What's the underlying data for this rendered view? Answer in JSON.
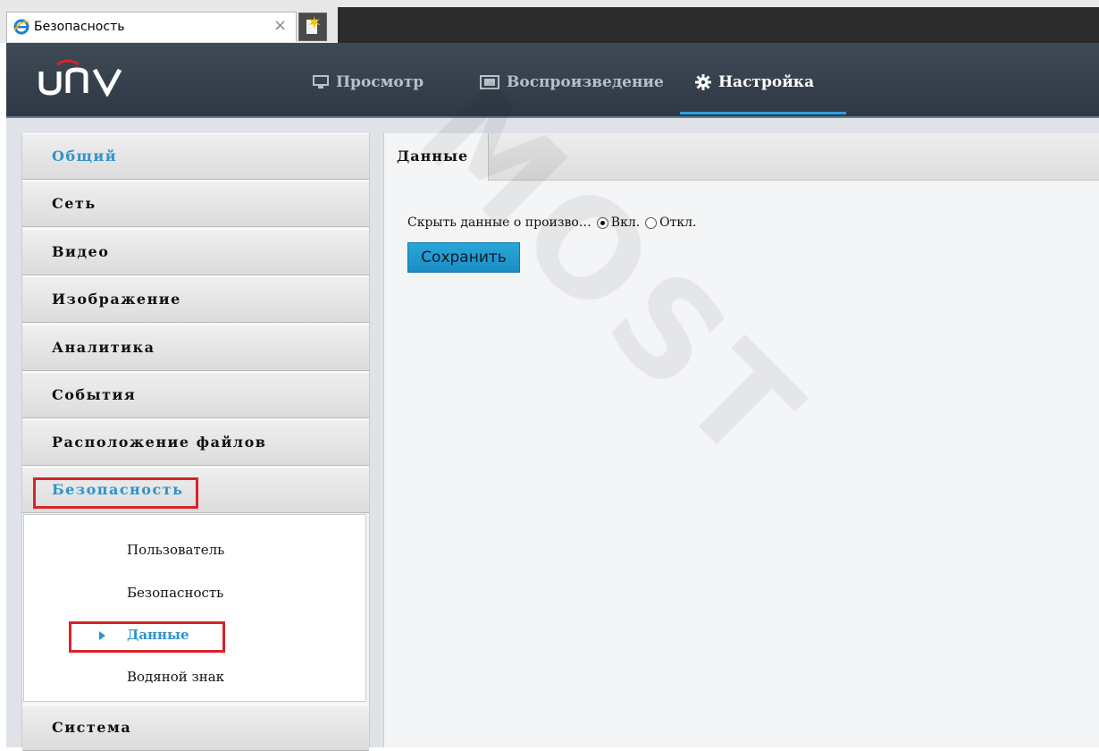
{
  "browser": {
    "tab_title": "Безопасность",
    "tab_close": "×"
  },
  "header": {
    "logo": "UNV",
    "nav": [
      {
        "label": "Просмотр",
        "icon": "monitor-icon"
      },
      {
        "label": "Воспроизведение",
        "icon": "film-icon"
      },
      {
        "label": "Настройка",
        "icon": "gear-icon",
        "active": true
      }
    ],
    "accent": "#2ea0e0",
    "background": "#3f4a57"
  },
  "sidebar": {
    "items": [
      {
        "label": "Общий",
        "highlight": true
      },
      {
        "label": "Сеть"
      },
      {
        "label": "Видео"
      },
      {
        "label": "Изображение"
      },
      {
        "label": "Аналитика"
      },
      {
        "label": "События"
      },
      {
        "label": "Расположение файлов"
      },
      {
        "label": "Безопасность",
        "expanded": true,
        "boxed": true
      }
    ],
    "subitems": [
      {
        "label": "Пользователь"
      },
      {
        "label": "Безопасность"
      },
      {
        "label": "Данные",
        "active": true,
        "boxed": true
      },
      {
        "label": "Водяной знак"
      }
    ],
    "last_item": {
      "label": "Система"
    },
    "accent_blue": "#2f93c9",
    "box_red": "#d8232a"
  },
  "main": {
    "tab_label": "Данные",
    "field_label": "Скрыть данные о произво…",
    "option_on": "Вкл.",
    "option_off": "Откл.",
    "selected": "on",
    "save_label": "Сохранить"
  },
  "watermark": "MOST"
}
